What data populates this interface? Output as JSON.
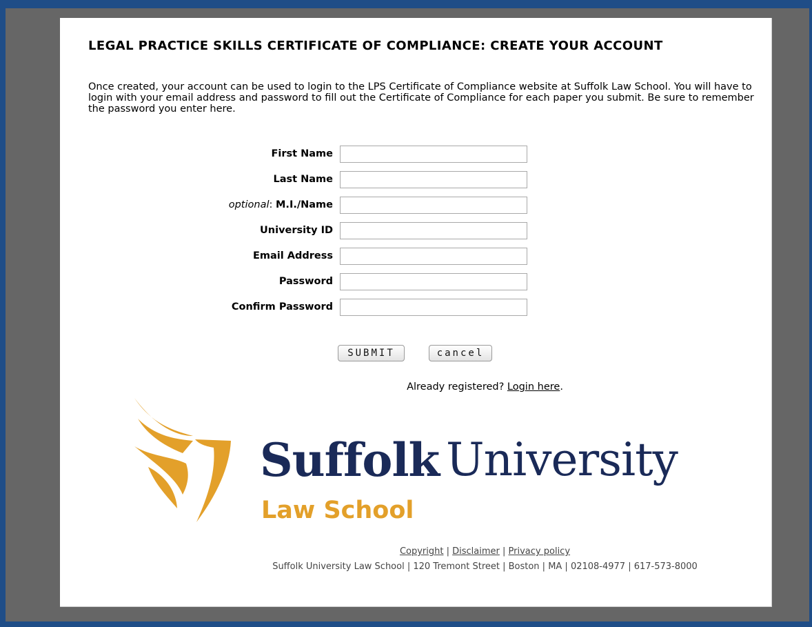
{
  "page": {
    "title": "LEGAL PRACTICE SKILLS CERTIFICATE OF COMPLIANCE: CREATE YOUR ACCOUNT",
    "intro": "Once created, your account can be used to login to the LPS Certificate of Compliance website at Suffolk Law School. You will have to login with your email address and password to fill out the Certificate of Compliance for each paper you submit. Be sure to remember the password you enter here."
  },
  "form": {
    "first_name_label": "First Name",
    "last_name_label": "Last Name",
    "optional_prefix": "optional",
    "mi_label": "M.I./Name",
    "university_id_label": "University ID",
    "email_label": "Email Address",
    "password_label": "Password",
    "confirm_password_label": "Confirm Password",
    "first_name_value": "",
    "last_name_value": "",
    "mi_value": "",
    "university_id_value": "",
    "email_value": "",
    "password_value": "",
    "confirm_password_value": "",
    "submit_label": "SUBMIT",
    "cancel_label": "cancel"
  },
  "login": {
    "prompt": "Already registered?",
    "link_label": "Login here"
  },
  "logo": {
    "word1": "Suffolk",
    "word2": "University",
    "subtitle": "Law School",
    "navy": "#1a2a58",
    "gold": "#e3a02a"
  },
  "footer": {
    "copyright": "Copyright",
    "disclaimer": "Disclaimer",
    "privacy": "Privacy policy",
    "address": "Suffolk University Law School | 120 Tremont Street | Boston | MA | 02108-4977 | 617-573-8000"
  }
}
